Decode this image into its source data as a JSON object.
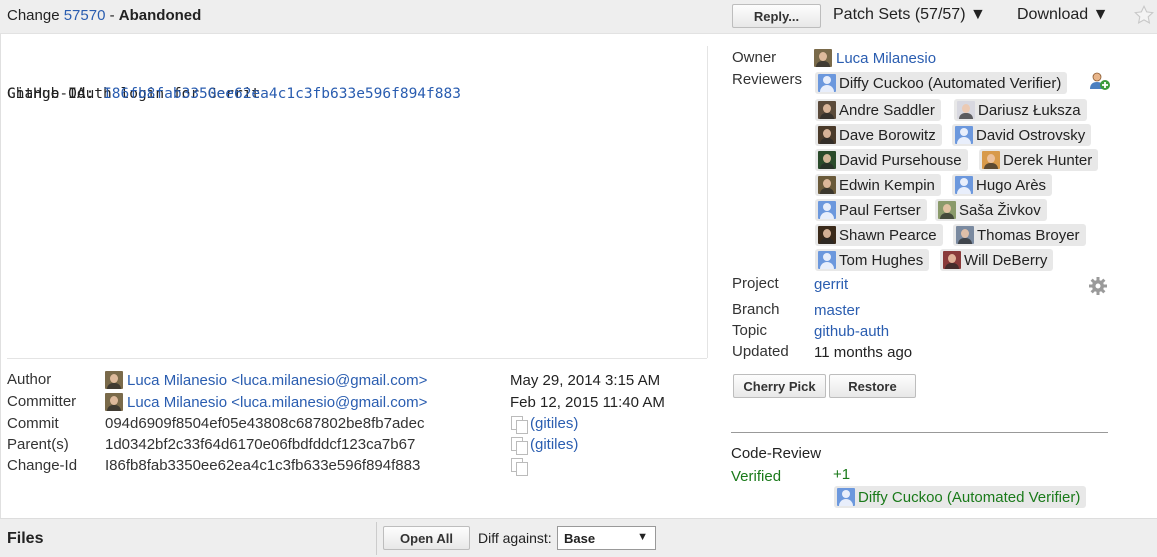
{
  "header": {
    "change_label": "Change",
    "change_number": "57570",
    "separator": "-",
    "status": "Abandoned",
    "reply_label": "Reply...",
    "patch_sets_label": "Patch Sets (57/57)",
    "download_label": "Download",
    "dropdown_arrow": "▼"
  },
  "commit_message": {
    "subject": "GitHub OAuth login for Gerrit",
    "change_id_label": "Change-Id: ",
    "change_id": "I86fb8fab3350ee62ea4c1c3fb633e596f894f883"
  },
  "commit_info": {
    "author_label": "Author",
    "author_value": "Luca Milanesio <luca.milanesio@gmail.com>",
    "author_date": "May 29, 2014 3:15 AM",
    "committer_label": "Committer",
    "committer_value": "Luca Milanesio <luca.milanesio@gmail.com>",
    "committer_date": "Feb 12, 2015 11:40 AM",
    "commit_label": "Commit",
    "commit_value": "094d6909f8504ef05e43808c687802be8fb7adec",
    "parents_label": "Parent(s)",
    "parents_value": "1d0342bf2c33f64d6170e06fbdfddcf123ca7b67",
    "changeid_label": "Change-Id",
    "changeid_value": "I86fb8fab3350ee62ea4c1c3fb633e596f894f883",
    "gitiles_label": "(gitiles)"
  },
  "sidebar": {
    "owner_label": "Owner",
    "owner_name": "Luca Milanesio",
    "reviewers_label": "Reviewers",
    "reviewers": [
      "Diffy Cuckoo (Automated Verifier)",
      "Andre Saddler",
      "Dariusz Łuksza",
      "Dave Borowitz",
      "David Ostrovsky",
      "David Pursehouse",
      "Derek Hunter",
      "Edwin Kempin",
      "Hugo Arès",
      "Paul Fertser",
      "Saša Živkov",
      "Shawn Pearce",
      "Thomas Broyer",
      "Tom Hughes",
      "Will DeBerry"
    ],
    "project_label": "Project",
    "project_value": "gerrit",
    "branch_label": "Branch",
    "branch_value": "master",
    "topic_label": "Topic",
    "topic_value": "github-auth",
    "updated_label": "Updated",
    "updated_value": "11 months ago",
    "cherry_pick_label": "Cherry Pick",
    "restore_label": "Restore"
  },
  "labels": {
    "code_review_title": "Code-Review",
    "verified_label": "Verified",
    "verified_score": "+1",
    "verified_by": "Diffy Cuckoo (Automated Verifier)"
  },
  "files": {
    "title": "Files",
    "open_all_label": "Open All",
    "diff_against_label": "Diff against:",
    "diff_against_value": "Base"
  },
  "colors": {
    "link": "#2a5db0",
    "verified_green": "#1a7a1a",
    "header_bg": "#eeeeee",
    "chip_bg": "#e8e8e8"
  }
}
